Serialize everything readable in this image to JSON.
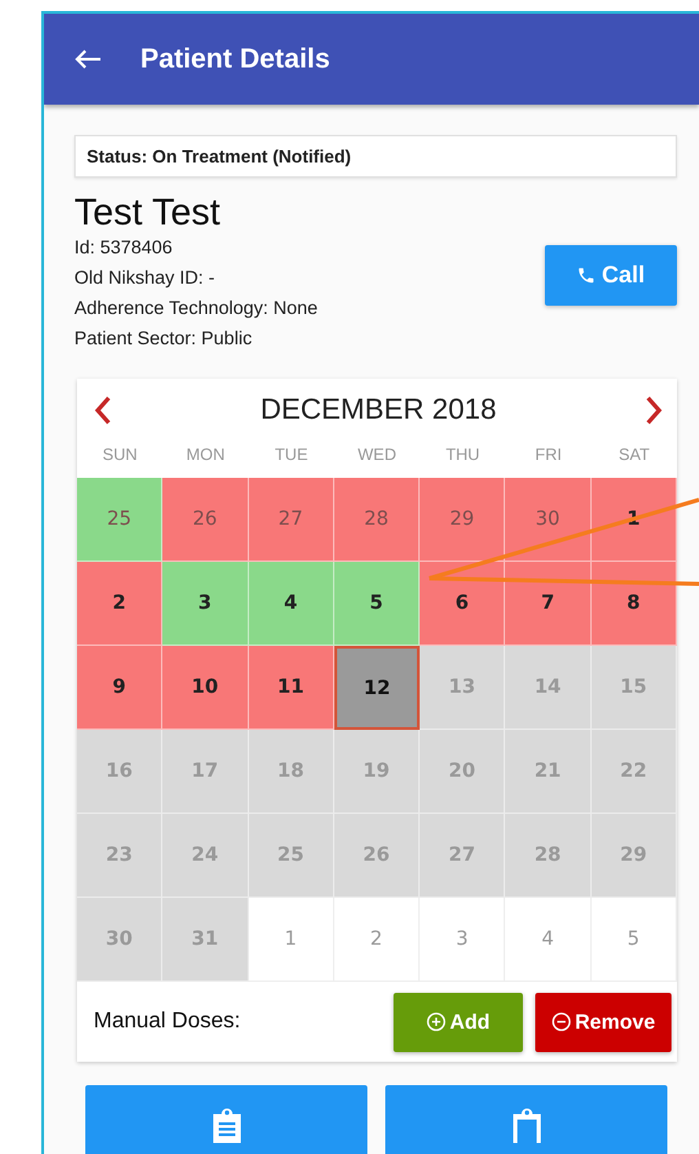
{
  "app_bar": {
    "title": "Patient Details"
  },
  "status": "Status: On Treatment (Notified)",
  "patient": {
    "name": "Test Test",
    "details": [
      "Id: 5378406",
      "Old Nikshay ID: -",
      "Adherence Technology: None",
      "Patient Sector: Public"
    ],
    "call_button": "Call"
  },
  "calendar": {
    "month": "DECEMBER 2018",
    "weekdays": [
      "SUN",
      "MON",
      "TUE",
      "WED",
      "THU",
      "FRI",
      "SAT"
    ],
    "days": [
      {
        "day": "25",
        "kind": "taken",
        "faded": true
      },
      {
        "day": "26",
        "kind": "missed",
        "faded": true
      },
      {
        "day": "27",
        "kind": "missed",
        "faded": true
      },
      {
        "day": "28",
        "kind": "missed",
        "faded": true
      },
      {
        "day": "29",
        "kind": "missed",
        "faded": true
      },
      {
        "day": "30",
        "kind": "missed",
        "faded": true
      },
      {
        "day": "1",
        "kind": "missed",
        "faded": false
      },
      {
        "day": "2",
        "kind": "missed",
        "faded": false
      },
      {
        "day": "3",
        "kind": "taken",
        "faded": false
      },
      {
        "day": "4",
        "kind": "taken",
        "faded": false
      },
      {
        "day": "5",
        "kind": "taken",
        "faded": false
      },
      {
        "day": "6",
        "kind": "missed",
        "faded": false
      },
      {
        "day": "7",
        "kind": "missed",
        "faded": false
      },
      {
        "day": "8",
        "kind": "missed",
        "faded": false
      },
      {
        "day": "9",
        "kind": "missed",
        "faded": false
      },
      {
        "day": "10",
        "kind": "missed",
        "faded": false
      },
      {
        "day": "11",
        "kind": "missed",
        "faded": false
      },
      {
        "day": "12",
        "kind": "today",
        "faded": false
      },
      {
        "day": "13",
        "kind": "future",
        "faded": false
      },
      {
        "day": "14",
        "kind": "future",
        "faded": false
      },
      {
        "day": "15",
        "kind": "future",
        "faded": false
      },
      {
        "day": "16",
        "kind": "future",
        "faded": false
      },
      {
        "day": "17",
        "kind": "future",
        "faded": false
      },
      {
        "day": "18",
        "kind": "future",
        "faded": false
      },
      {
        "day": "19",
        "kind": "future",
        "faded": false
      },
      {
        "day": "20",
        "kind": "future",
        "faded": false
      },
      {
        "day": "21",
        "kind": "future",
        "faded": false
      },
      {
        "day": "22",
        "kind": "future",
        "faded": false
      },
      {
        "day": "23",
        "kind": "future",
        "faded": false
      },
      {
        "day": "24",
        "kind": "future",
        "faded": false
      },
      {
        "day": "25",
        "kind": "future",
        "faded": false
      },
      {
        "day": "26",
        "kind": "future",
        "faded": false
      },
      {
        "day": "27",
        "kind": "future",
        "faded": false
      },
      {
        "day": "28",
        "kind": "future",
        "faded": false
      },
      {
        "day": "29",
        "kind": "future",
        "faded": false
      },
      {
        "day": "30",
        "kind": "future",
        "faded": false
      },
      {
        "day": "31",
        "kind": "future",
        "faded": false
      },
      {
        "day": "1",
        "kind": "outside",
        "faded": true
      },
      {
        "day": "2",
        "kind": "outside",
        "faded": true
      },
      {
        "day": "3",
        "kind": "outside",
        "faded": true
      },
      {
        "day": "4",
        "kind": "outside",
        "faded": true
      },
      {
        "day": "5",
        "kind": "outside",
        "faded": true
      }
    ],
    "manual_doses": {
      "label": "Manual Doses:",
      "add": "Add",
      "remove": "Remove"
    }
  }
}
